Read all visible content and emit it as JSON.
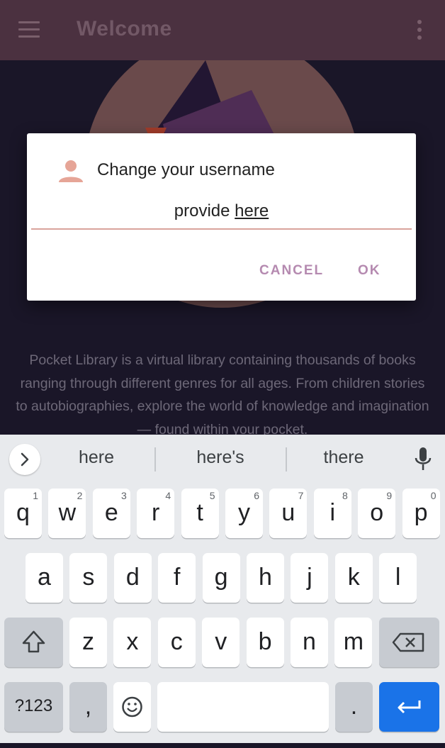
{
  "appbar": {
    "title": "Welcome",
    "menu_icon": "hamburger-menu-icon",
    "overflow_icon": "more-vert-icon"
  },
  "description": "Pocket Library is a virtual library containing thousands of books ranging through different genres for all ages. From children stories to autobiographies, explore the world of knowledge and imagination — found within your pocket.",
  "dialog": {
    "icon": "person-icon",
    "title": "Change your username",
    "input_prefix": "provide ",
    "input_underlined": "here",
    "cancel_label": "CANCEL",
    "ok_label": "OK",
    "accent_color": "#b58ab0",
    "underline_color": "#d9a39c"
  },
  "keyboard": {
    "suggestions": [
      "here",
      "here's",
      "there"
    ],
    "row1": [
      {
        "k": "q",
        "h": "1"
      },
      {
        "k": "w",
        "h": "2"
      },
      {
        "k": "e",
        "h": "3"
      },
      {
        "k": "r",
        "h": "4"
      },
      {
        "k": "t",
        "h": "5"
      },
      {
        "k": "y",
        "h": "6"
      },
      {
        "k": "u",
        "h": "7"
      },
      {
        "k": "i",
        "h": "8"
      },
      {
        "k": "o",
        "h": "9"
      },
      {
        "k": "p",
        "h": "0"
      }
    ],
    "row2": [
      "a",
      "s",
      "d",
      "f",
      "g",
      "h",
      "j",
      "k",
      "l"
    ],
    "row3": [
      "z",
      "x",
      "c",
      "v",
      "b",
      "n",
      "m"
    ],
    "sym_label": "?123",
    "comma": ",",
    "period": ".",
    "enter_color": "#1a73e8"
  }
}
